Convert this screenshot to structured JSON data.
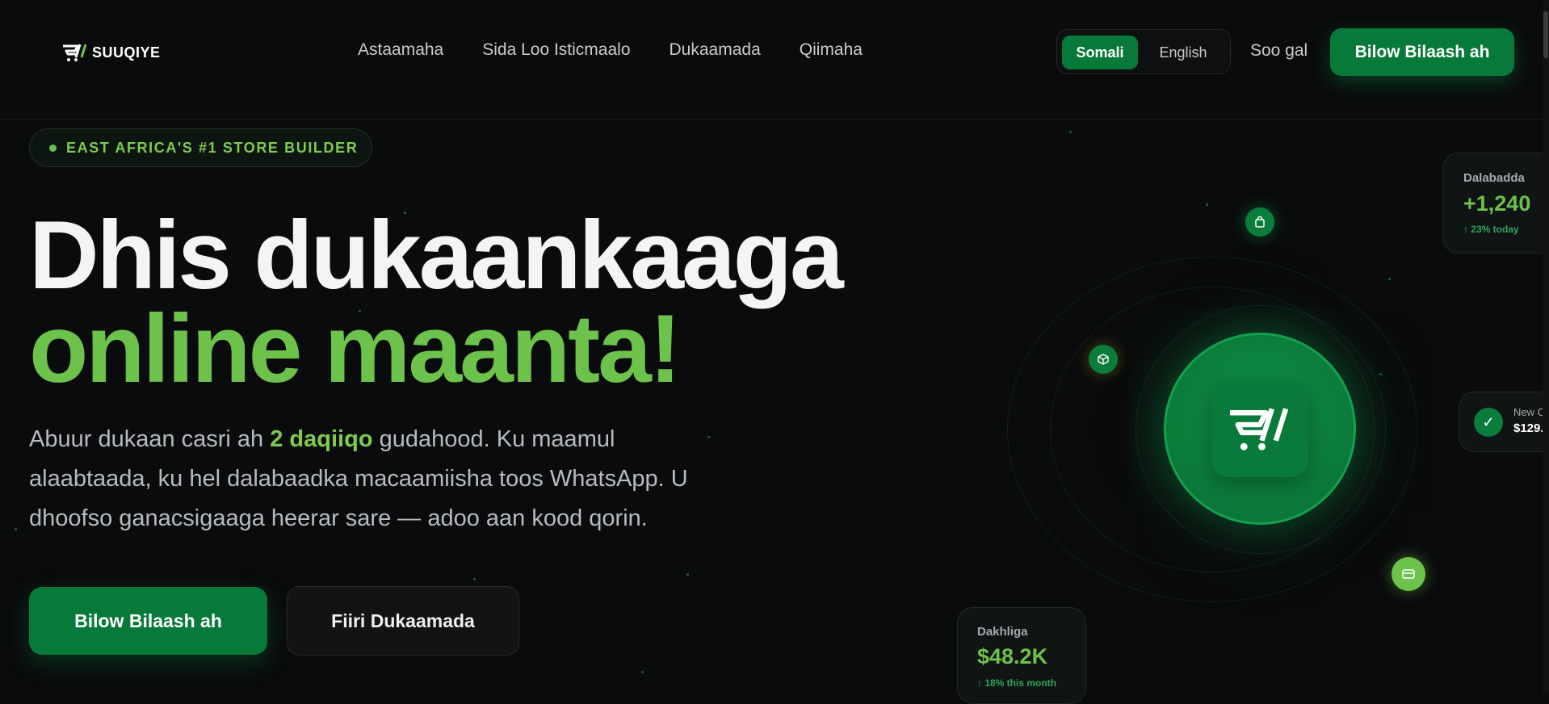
{
  "brand": {
    "name": "SUUQIYE"
  },
  "nav": {
    "items": [
      "Astaamaha",
      "Sida Loo Isticmaalo",
      "Dukaamada",
      "Qiimaha"
    ]
  },
  "language": {
    "active": "Somali",
    "other": "English"
  },
  "header": {
    "login": "Soo gal",
    "cta": "Bilow Bilaash ah"
  },
  "hero": {
    "badge": "EAST AFRICA'S #1 STORE BUILDER",
    "title_line1": "Dhis dukaankaaga",
    "title_line2": "online maanta!",
    "desc_before": "Abuur dukaan casri ah ",
    "desc_highlight": "2 daqiiqo",
    "desc_after": " gudahood. Ku maamul alaabtaada, ku hel dalabaadka macaamiisha toos WhatsApp. U dhoofso ganacsigaaga heerar sare — adoo aan kood qorin.",
    "primary_button": "Bilow Bilaash ah",
    "secondary_button": "Fiiri Dukaamada"
  },
  "stats": {
    "orders": {
      "label": "Dalabadda",
      "value": "+1,240",
      "sub": "↑ 23% today"
    },
    "revenue": {
      "label": "Dakhliga",
      "value": "$48.2K",
      "sub": "↑ 18% this month"
    },
    "new_order": {
      "label": "New O",
      "value": "$129."
    }
  },
  "colors": {
    "accent": "#077a3a",
    "lime": "#6cc24a",
    "bg": "#0a0b0c"
  },
  "icons": {
    "logo": "cart-logo-icon",
    "bag": "shopping-bag-icon",
    "box": "package-icon",
    "card": "credit-card-icon",
    "check": "check-icon"
  }
}
